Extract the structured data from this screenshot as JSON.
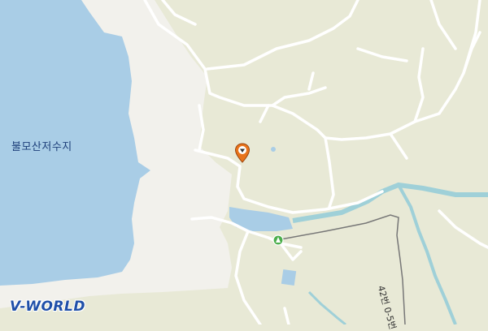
{
  "map": {
    "water_label": "불모산저수지",
    "road_label": "42번 0-5번",
    "brand": "V-WORLD",
    "colors": {
      "land": "#e8e9d6",
      "water": "#a9cde6",
      "bare": "#f2f1ec",
      "road": "#ffffff",
      "stream": "#9fd0d8",
      "boundary": "#777777",
      "marker": "#e8731a",
      "brand": "#1f4fa8"
    },
    "marker": {
      "icon": "location-pin-icon"
    },
    "poi": {
      "icon": "park-icon"
    }
  }
}
